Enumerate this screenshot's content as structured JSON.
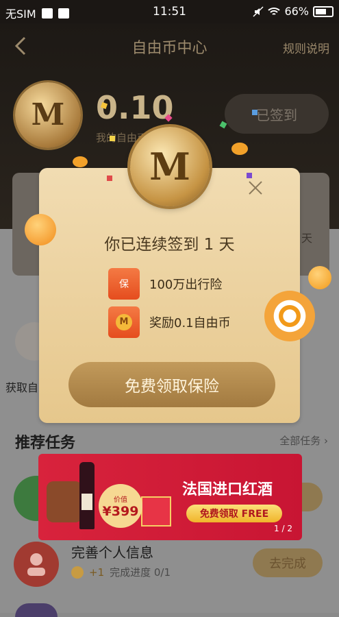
{
  "status_bar": {
    "carrier": "无SIM",
    "time": "11:51",
    "battery": "66%"
  },
  "nav": {
    "title": "自由币中心",
    "rules": "规则说明"
  },
  "account": {
    "balance": "0.10",
    "balance_label": "我的自由币",
    "signed_label": "已签到"
  },
  "modal": {
    "title": "你已连续签到 1 天",
    "rewards": [
      {
        "icon": "保",
        "text": "100万出行险"
      },
      {
        "icon": "M",
        "text": "奖励0.1自由币"
      }
    ],
    "cta": "免费领取保险"
  },
  "side": {
    "label": "获取自",
    "card_right": "天"
  },
  "tasks_section": {
    "title": "推荐任务",
    "all": "全部任务",
    "tasks": [
      {
        "title": "",
        "reward": "",
        "progress": "",
        "button": "成"
      },
      {
        "title": "完善个人信息",
        "reward": "+1",
        "progress": "完成进度 0/1",
        "button": "去完成"
      }
    ]
  },
  "ad": {
    "title": "法国进口红酒",
    "cta": "免费领取 FREE",
    "price_label": "价值",
    "price": "¥399",
    "pager": "1 / 2"
  },
  "colors": {
    "header_bg": "#1d1915",
    "gold": "#c9b48a",
    "modal_bg": "#f1dcb2",
    "claim_btn": "#b08a4c",
    "ad_red": "#d8233c"
  }
}
